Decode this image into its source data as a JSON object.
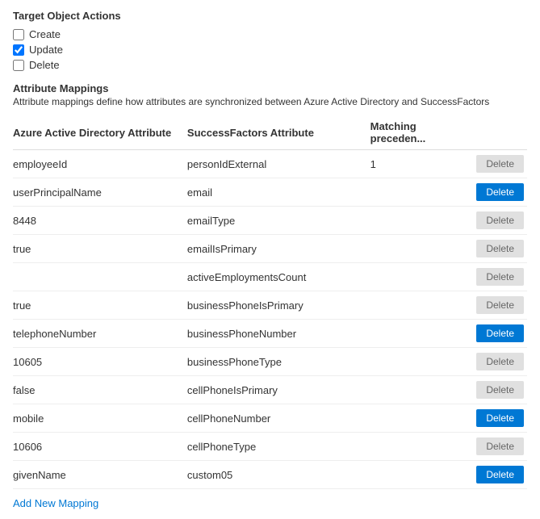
{
  "targetObjectActions": {
    "title": "Target Object Actions",
    "checkboxes": [
      {
        "id": "create",
        "label": "Create",
        "checked": false
      },
      {
        "id": "update",
        "label": "Update",
        "checked": true
      },
      {
        "id": "delete",
        "label": "Delete",
        "checked": false
      }
    ]
  },
  "attributeMappings": {
    "title": "Attribute Mappings",
    "description": "Attribute mappings define how attributes are synchronized between Azure Active Directory and SuccessFactors",
    "columns": {
      "aad": "Azure Active Directory Attribute",
      "sf": "SuccessFactors Attribute",
      "mp": "Matching preceden...",
      "del": ""
    },
    "rows": [
      {
        "aad": "employeeId",
        "sf": "personIdExternal",
        "mp": "1",
        "active": false
      },
      {
        "aad": "userPrincipalName",
        "sf": "email",
        "mp": "",
        "active": true
      },
      {
        "aad": "8448",
        "sf": "emailType",
        "mp": "",
        "active": false
      },
      {
        "aad": "true",
        "sf": "emailIsPrimary",
        "mp": "",
        "active": false
      },
      {
        "aad": "",
        "sf": "activeEmploymentsCount",
        "mp": "",
        "active": false
      },
      {
        "aad": "true",
        "sf": "businessPhoneIsPrimary",
        "mp": "",
        "active": false
      },
      {
        "aad": "telephoneNumber",
        "sf": "businessPhoneNumber",
        "mp": "",
        "active": true
      },
      {
        "aad": "10605",
        "sf": "businessPhoneType",
        "mp": "",
        "active": false
      },
      {
        "aad": "false",
        "sf": "cellPhoneIsPrimary",
        "mp": "",
        "active": false
      },
      {
        "aad": "mobile",
        "sf": "cellPhoneNumber",
        "mp": "",
        "active": true
      },
      {
        "aad": "10606",
        "sf": "cellPhoneType",
        "mp": "",
        "active": false
      },
      {
        "aad": "givenName",
        "sf": "custom05",
        "mp": "",
        "active": true
      }
    ],
    "deleteLabel": "Delete",
    "addNewMappingLabel": "Add New Mapping"
  }
}
